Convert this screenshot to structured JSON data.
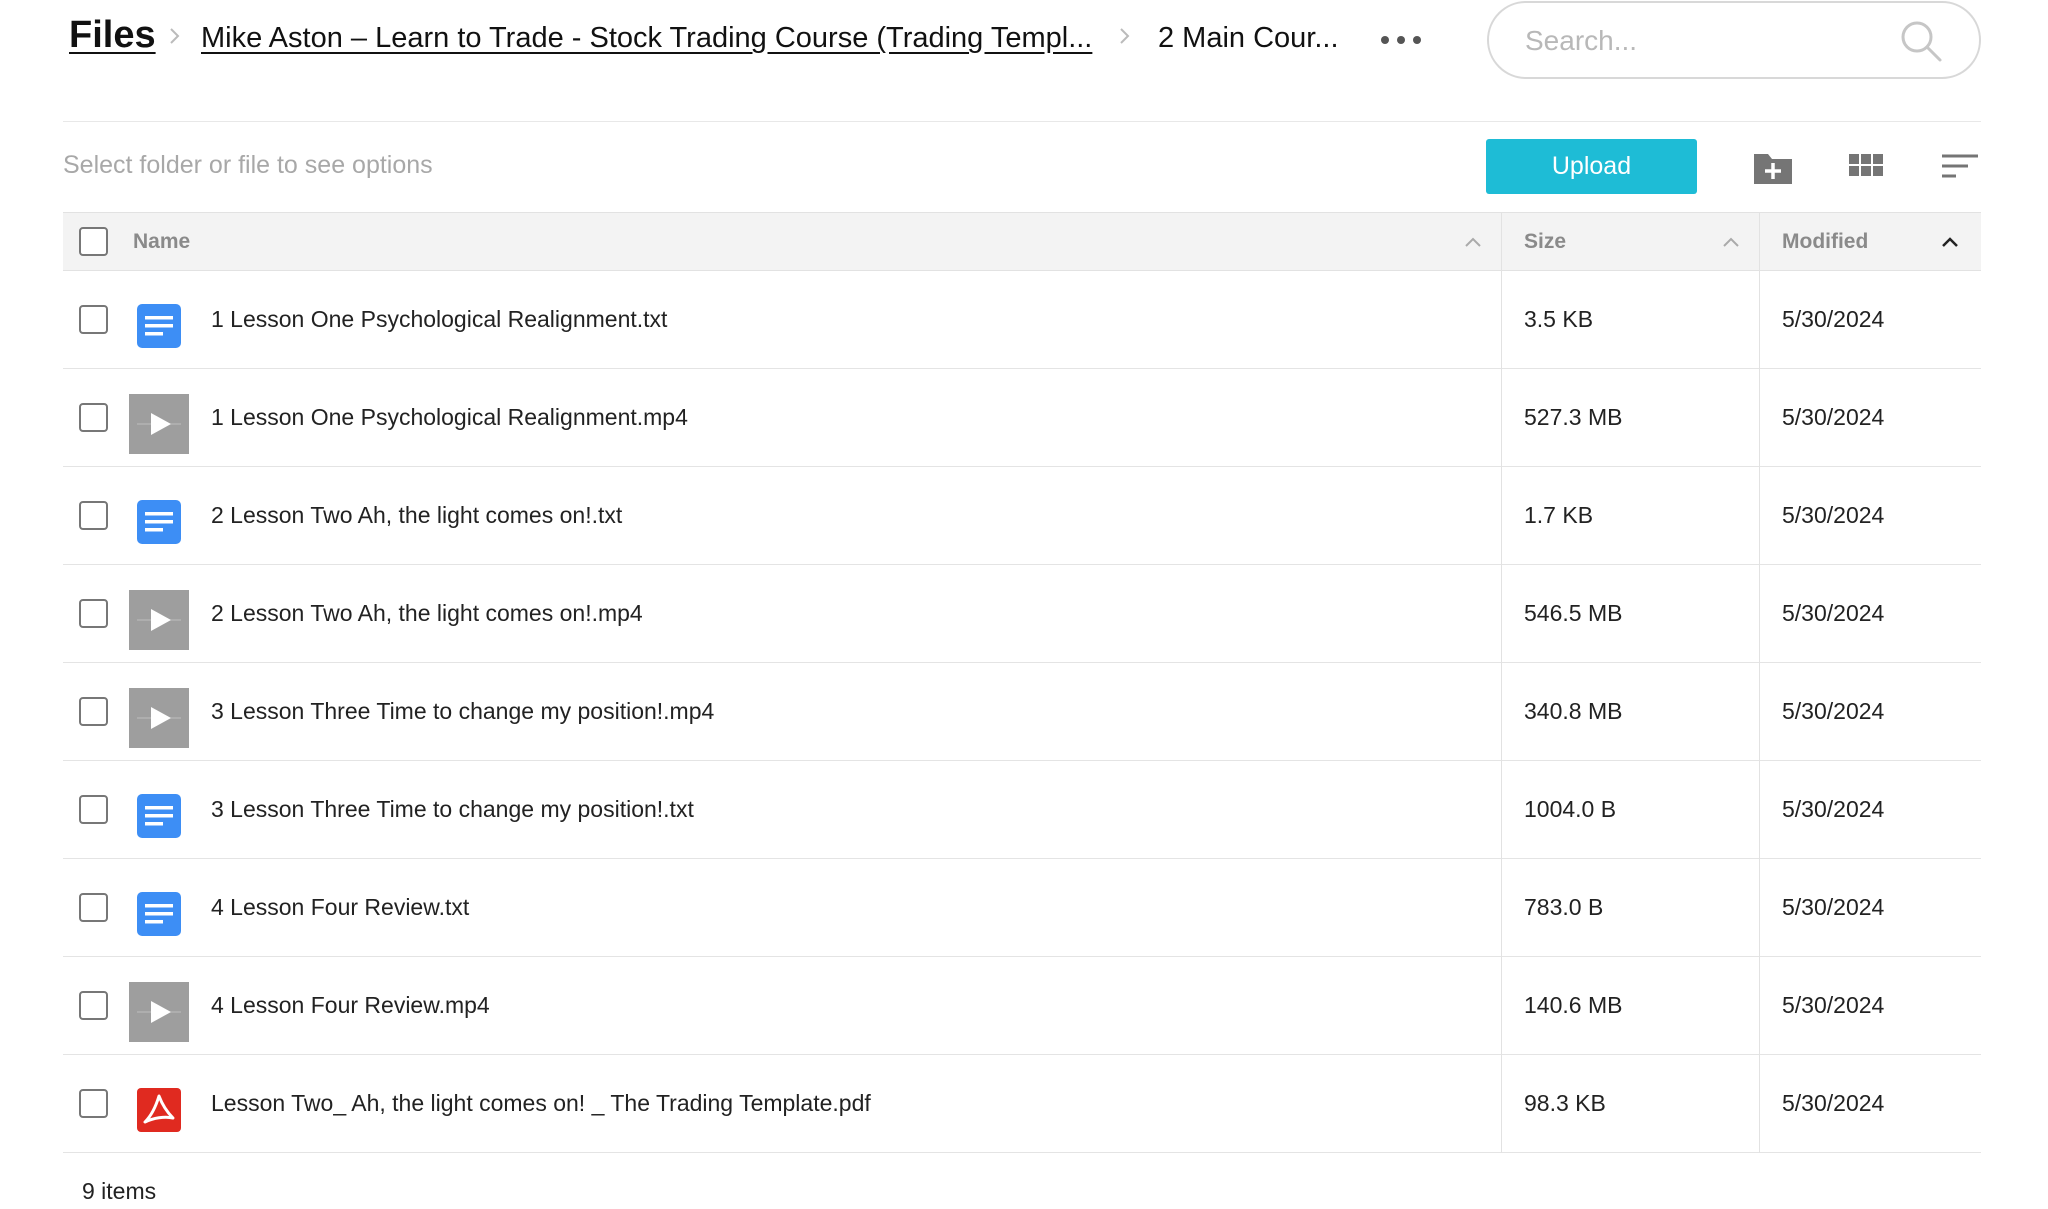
{
  "breadcrumb": {
    "root": "Files",
    "folder": "Mike Aston – Learn to Trade - Stock Trading Course (Trading Templ...",
    "current": "2 Main Cour..."
  },
  "search": {
    "placeholder": "Search..."
  },
  "toolbar": {
    "hint": "Select folder or file to see options",
    "upload_label": "Upload"
  },
  "table": {
    "columns": {
      "name": "Name",
      "size": "Size",
      "modified": "Modified"
    },
    "rows": [
      {
        "name": "1 Lesson One Psychological Realignment.txt",
        "size": "3.5 KB",
        "modified": "5/30/2024",
        "type": "doc-icon"
      },
      {
        "name": "1 Lesson One Psychological Realignment.mp4",
        "size": "527.3 MB",
        "modified": "5/30/2024",
        "type": "video-thumbnail-icon"
      },
      {
        "name": "2 Lesson Two Ah, the light comes on!.txt",
        "size": "1.7 KB",
        "modified": "5/30/2024",
        "type": "doc-icon"
      },
      {
        "name": "2 Lesson Two Ah, the light comes on!.mp4",
        "size": "546.5 MB",
        "modified": "5/30/2024",
        "type": "video-thumbnail-icon"
      },
      {
        "name": "3 Lesson Three Time to change my position!.mp4",
        "size": "340.8 MB",
        "modified": "5/30/2024",
        "type": "video-thumbnail-icon"
      },
      {
        "name": "3 Lesson Three Time to change my position!.txt",
        "size": "1004.0 B",
        "modified": "5/30/2024",
        "type": "doc-icon"
      },
      {
        "name": "4 Lesson Four Review.txt",
        "size": "783.0 B",
        "modified": "5/30/2024",
        "type": "doc-icon"
      },
      {
        "name": "4 Lesson Four Review.mp4",
        "size": "140.6 MB",
        "modified": "5/30/2024",
        "type": "video-thumbnail-icon"
      },
      {
        "name": "Lesson Two_ Ah, the light comes on! _ The Trading Template.pdf",
        "size": "98.3 KB",
        "modified": "5/30/2024",
        "type": "pdf-icon"
      }
    ]
  },
  "footer": {
    "count": "9 items"
  },
  "colors": {
    "accent": "#1ebcd6",
    "doc": "#3d8ef5",
    "pdf": "#e02a20",
    "video": "#9e9e9e"
  }
}
